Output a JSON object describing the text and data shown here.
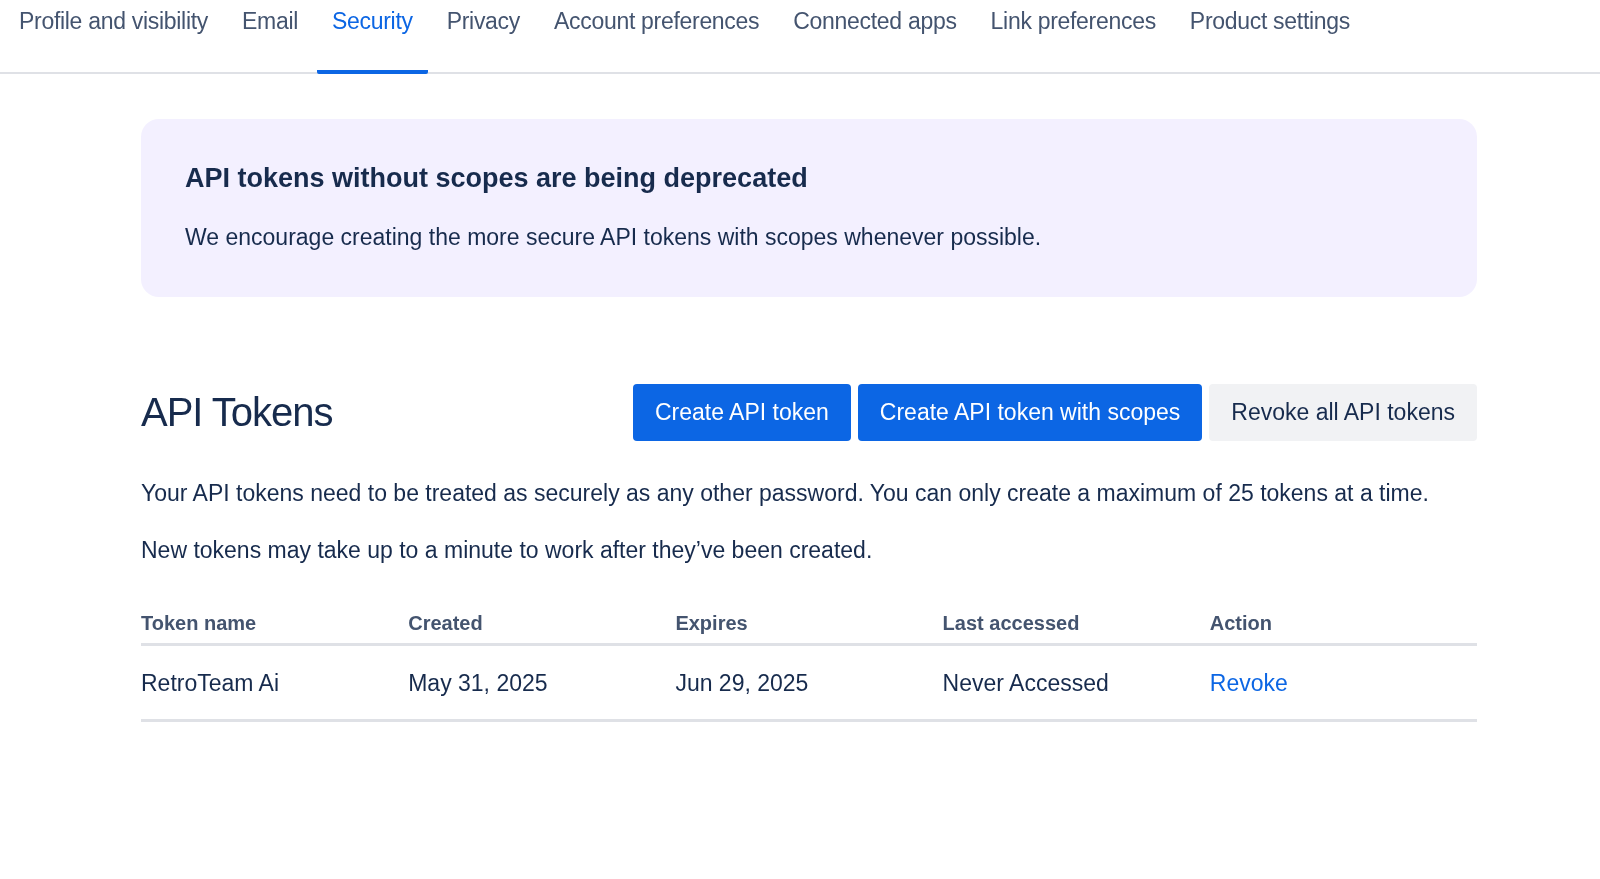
{
  "tabs": [
    {
      "label": "Profile and visibility",
      "selected": false
    },
    {
      "label": "Email",
      "selected": false
    },
    {
      "label": "Security",
      "selected": true
    },
    {
      "label": "Privacy",
      "selected": false
    },
    {
      "label": "Account preferences",
      "selected": false
    },
    {
      "label": "Connected apps",
      "selected": false
    },
    {
      "label": "Link preferences",
      "selected": false
    },
    {
      "label": "Product settings",
      "selected": false
    }
  ],
  "banner": {
    "title": "API tokens without scopes are being deprecated",
    "message": "We encourage creating the more secure API tokens with scopes whenever possible."
  },
  "section": {
    "title": "API Tokens",
    "buttons": [
      {
        "label": "Create API token",
        "kind": "primary"
      },
      {
        "label": "Create API token with scopes",
        "kind": "primary"
      },
      {
        "label": "Revoke all API tokens",
        "kind": "secondary"
      }
    ],
    "paragraphs": [
      "Your API tokens need to be treated as securely as any other password. You can only create a maximum of 25 tokens at a time.",
      "New tokens may take up to a minute to work after they’ve been created."
    ]
  },
  "table": {
    "columns": [
      "Token name",
      "Created",
      "Expires",
      "Last accessed",
      "Action"
    ],
    "rows": [
      {
        "token_name": "RetroTeam Ai",
        "created": "May 31, 2025",
        "expires": "Jun 29, 2025",
        "last_accessed": "Never Accessed",
        "action": "Revoke"
      }
    ]
  }
}
